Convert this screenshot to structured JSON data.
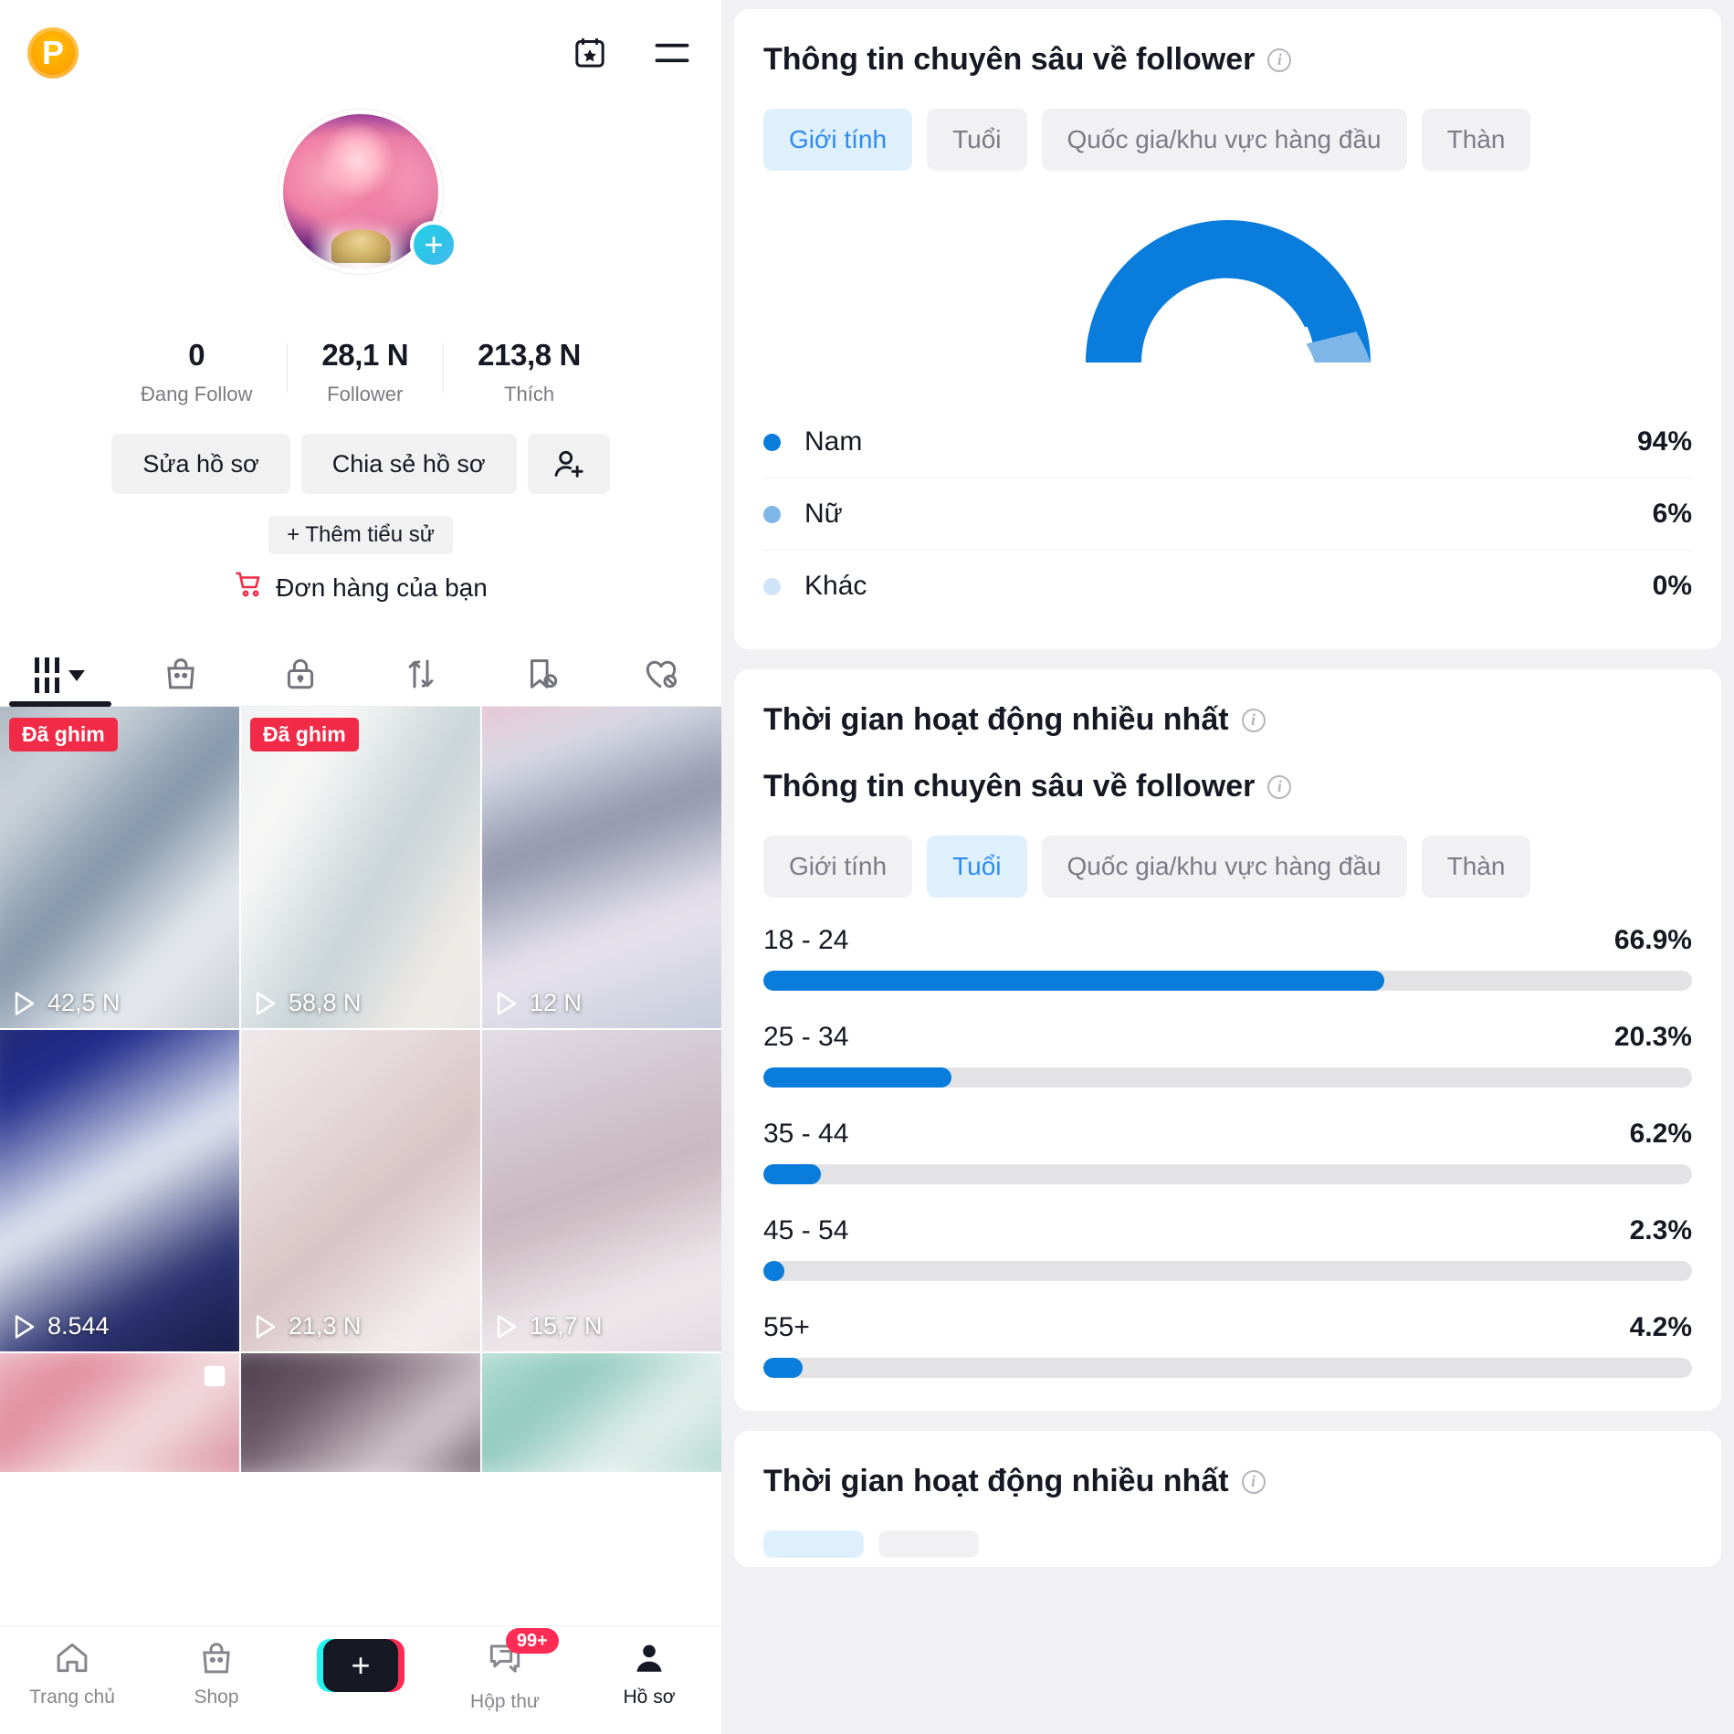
{
  "colors": {
    "accent_blue": "#0a7cdc",
    "mid_blue": "#6fb0e8",
    "light_blue": "#cfe4f7",
    "chip_active_bg": "#dff0fd",
    "chip_active_text": "#2d8bf0",
    "pin_red": "#f12b47",
    "track_grey": "#e3e3e6"
  },
  "phone": {
    "topbar": {
      "pro_badge_label": "P",
      "pro_badge_icon": "pro-badge-icon",
      "calendar_star_icon": "calendar-star-icon",
      "menu_icon": "hamburger-menu-icon"
    },
    "profile": {
      "avatar_icon": "profile-avatar",
      "add_story_icon": "plus-icon",
      "stats": [
        {
          "value": "0",
          "label": "Đang Follow"
        },
        {
          "value": "28,1 N",
          "label": "Follower"
        },
        {
          "value": "213,8 N",
          "label": "Thích"
        }
      ],
      "edit_profile_label": "Sửa hồ sơ",
      "share_profile_label": "Chia sẻ hồ sơ",
      "add_friend_icon": "add-user-icon",
      "add_bio_label": "+ Thêm tiểu sử",
      "orders_label": "Đơn hàng của bạn",
      "orders_icon": "shopping-cart-icon"
    },
    "content_tabs": [
      {
        "icon": "grid-bars-icon",
        "name": "videos",
        "active": true,
        "has_caret": true
      },
      {
        "icon": "shopping-bag-icon",
        "name": "shop",
        "active": false,
        "has_caret": false
      },
      {
        "icon": "lock-icon",
        "name": "private",
        "active": false,
        "has_caret": false
      },
      {
        "icon": "repost-arrows-icon",
        "name": "reposts",
        "active": false,
        "has_caret": false
      },
      {
        "icon": "bookmark-hidden-icon",
        "name": "saved",
        "active": false,
        "has_caret": false
      },
      {
        "icon": "heart-hidden-icon",
        "name": "liked",
        "active": false,
        "has_caret": false
      }
    ],
    "videos": [
      {
        "views": "42,5 N",
        "pinned_label": "Đã ghim",
        "pinned": true,
        "thumb": "t1",
        "carousel": false
      },
      {
        "views": "58,8 N",
        "pinned_label": "Đã ghim",
        "pinned": true,
        "thumb": "t2",
        "carousel": false
      },
      {
        "views": "12 N",
        "pinned_label": "",
        "pinned": false,
        "thumb": "t3",
        "carousel": false
      },
      {
        "views": "8.544",
        "pinned_label": "",
        "pinned": false,
        "thumb": "t4",
        "carousel": false
      },
      {
        "views": "21,3 N",
        "pinned_label": "",
        "pinned": false,
        "thumb": "t5",
        "carousel": false
      },
      {
        "views": "15,7 N",
        "pinned_label": "",
        "pinned": false,
        "thumb": "t6",
        "carousel": false
      },
      {
        "views": "",
        "pinned_label": "",
        "pinned": false,
        "thumb": "t7",
        "carousel": true
      },
      {
        "views": "",
        "pinned_label": "",
        "pinned": false,
        "thumb": "t8",
        "carousel": false
      },
      {
        "views": "",
        "pinned_label": "",
        "pinned": false,
        "thumb": "t9",
        "carousel": false
      }
    ],
    "bottom_nav": [
      {
        "label": "Trang chủ",
        "icon": "home-icon",
        "active": false,
        "badge": ""
      },
      {
        "label": "Shop",
        "icon": "shopping-bag-icon",
        "active": false,
        "badge": ""
      },
      {
        "label": "",
        "icon": "create-plus-icon",
        "active": false,
        "badge": ""
      },
      {
        "label": "Hộp thư",
        "icon": "inbox-message-icon",
        "active": false,
        "badge": "99+"
      },
      {
        "label": "Hồ sơ",
        "icon": "person-icon",
        "active": true,
        "badge": ""
      }
    ]
  },
  "analytics": {
    "gender_card": {
      "title": "Thông tin chuyên sâu về follower",
      "info_icon": "info-icon",
      "tabs": [
        {
          "label": "Giới tính",
          "active": true
        },
        {
          "label": "Tuổi",
          "active": false
        },
        {
          "label": "Quốc gia/khu vực hàng đầu",
          "active": false
        },
        {
          "label": "Thàn",
          "active": false
        }
      ]
    },
    "activity_title": "Thời gian hoạt động nhiều nhất",
    "age_card": {
      "title": "Thông tin chuyên sâu về follower",
      "tabs": [
        {
          "label": "Giới tính",
          "active": false
        },
        {
          "label": "Tuổi",
          "active": true
        },
        {
          "label": "Quốc gia/khu vực hàng đầu",
          "active": false
        },
        {
          "label": "Thàn",
          "active": false
        }
      ]
    },
    "activity_title_2": "Thời gian hoạt động nhiều nhất"
  },
  "chart_data": [
    {
      "type": "pie",
      "title": "Thông tin chuyên sâu về follower - Giới tính",
      "subtitle": "",
      "style": "half-donut-gauge",
      "legend_position": "below",
      "labels": [
        "Nam",
        "Nữ",
        "Khác"
      ],
      "values": [
        94,
        6,
        0
      ],
      "value_labels": [
        "94%",
        "6%",
        "0%"
      ],
      "colors": [
        "#0a7cdc",
        "#6fb0e8",
        "#cfe4f7"
      ]
    },
    {
      "type": "bar",
      "title": "Thông tin chuyên sâu về follower - Tuổi",
      "orientation": "horizontal",
      "xlabel": "",
      "ylabel": "",
      "xlim": [
        0,
        100
      ],
      "grid": false,
      "categories": [
        "18 - 24",
        "25 - 34",
        "35 - 44",
        "45 - 54",
        "55+"
      ],
      "values": [
        66.9,
        20.3,
        6.2,
        2.3,
        4.2
      ],
      "value_labels": [
        "66.9%",
        "20.3%",
        "6.2%",
        "2.3%",
        "4.2%"
      ],
      "bar_color": "#0a7cdc",
      "track_color": "#e3e3e6"
    }
  ]
}
